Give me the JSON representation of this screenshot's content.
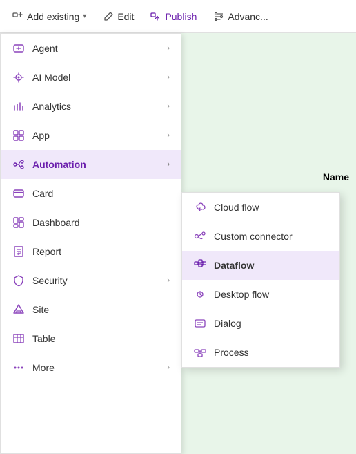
{
  "toolbar": {
    "add_existing_label": "Add existing",
    "edit_label": "Edit",
    "publish_label": "Publish",
    "advance_label": "Advanc..."
  },
  "primary_menu": {
    "items": [
      {
        "id": "agent",
        "label": "Agent",
        "has_submenu": true
      },
      {
        "id": "ai-model",
        "label": "AI Model",
        "has_submenu": true
      },
      {
        "id": "analytics",
        "label": "Analytics",
        "has_submenu": true
      },
      {
        "id": "app",
        "label": "App",
        "has_submenu": true
      },
      {
        "id": "automation",
        "label": "Automation",
        "has_submenu": true,
        "active": true
      },
      {
        "id": "card",
        "label": "Card",
        "has_submenu": false
      },
      {
        "id": "dashboard",
        "label": "Dashboard",
        "has_submenu": false
      },
      {
        "id": "report",
        "label": "Report",
        "has_submenu": false
      },
      {
        "id": "security",
        "label": "Security",
        "has_submenu": true
      },
      {
        "id": "site",
        "label": "Site",
        "has_submenu": false
      },
      {
        "id": "table",
        "label": "Table",
        "has_submenu": false
      },
      {
        "id": "more",
        "label": "More",
        "has_submenu": true
      }
    ]
  },
  "submenu": {
    "items": [
      {
        "id": "cloud-flow",
        "label": "Cloud flow",
        "active": false
      },
      {
        "id": "custom-connector",
        "label": "Custom connector",
        "active": false
      },
      {
        "id": "dataflow",
        "label": "Dataflow",
        "active": true
      },
      {
        "id": "desktop-flow",
        "label": "Desktop flow",
        "active": false
      },
      {
        "id": "dialog",
        "label": "Dialog",
        "active": false
      },
      {
        "id": "process",
        "label": "Process",
        "active": false
      }
    ]
  },
  "content": {
    "name_header": "Name"
  }
}
